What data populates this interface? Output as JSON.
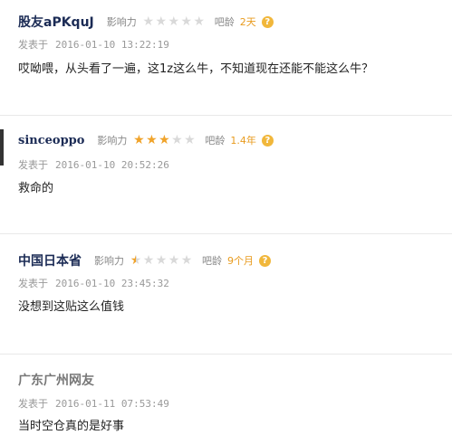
{
  "labels": {
    "influence": "影响力",
    "age": "吧龄",
    "posted_at": "发表于",
    "help": "?"
  },
  "comments": [
    {
      "username": "股友aPKquJ",
      "stars": "0 of 5",
      "age": "2天",
      "date": "2016-01-10 13:22:19",
      "text": "哎呦喂，从头看了一遍，这1z这么牛，不知道现在还能不能这么牛？"
    },
    {
      "username": "sinceoppo",
      "stars": "3 of 5",
      "age": "1.4年",
      "date": "2016-01-10 20:52:26",
      "text": "救命的"
    },
    {
      "username": "中国日本省",
      "stars": "0.5 of 5",
      "age": "9个月",
      "date": "2016-01-10 23:45:32",
      "text": "没想到这贴这么值钱"
    },
    {
      "username": "广东广州网友",
      "date": "2016-01-11 07:53:49",
      "text": "当时空仓真的是好事"
    }
  ],
  "colors": {
    "username": "#1b2b55",
    "guest_username": "#777777",
    "age": "#e89b1e",
    "star_on": "#f0a32a",
    "star_off": "#d9d9d9",
    "help_icon": "#f1b73b"
  }
}
